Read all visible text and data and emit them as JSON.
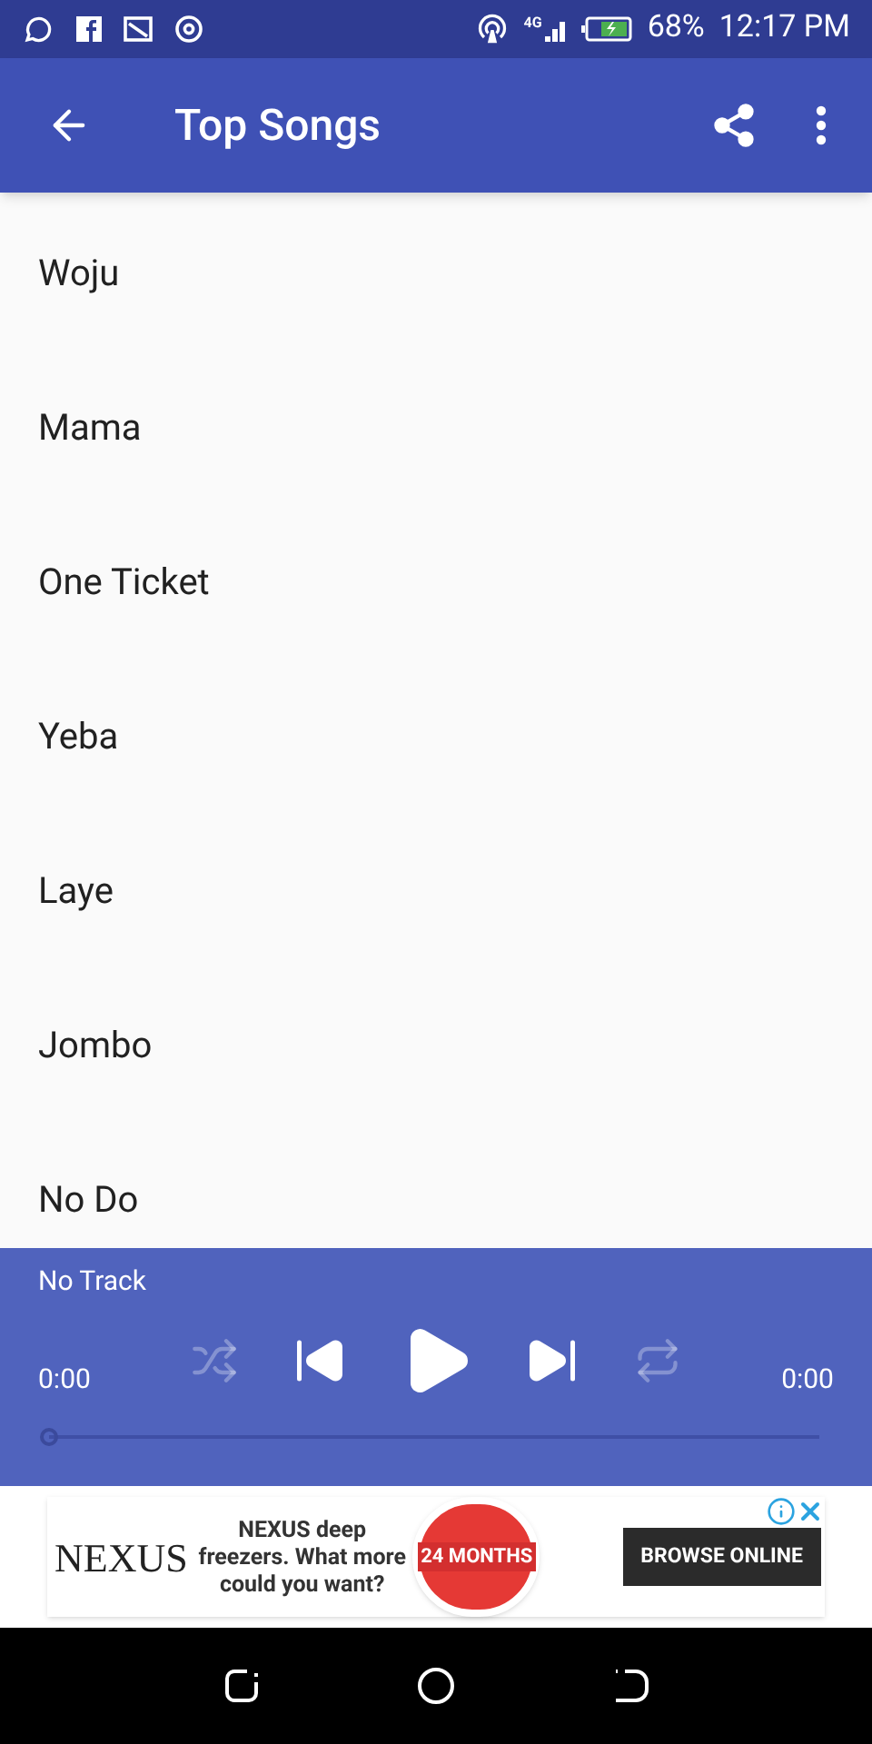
{
  "status_bar": {
    "network": "4G",
    "battery": "68%",
    "time": "12:17 PM"
  },
  "app_bar": {
    "title": "Top Songs"
  },
  "songs": [
    {
      "title": "Woju"
    },
    {
      "title": "Mama"
    },
    {
      "title": "One Ticket"
    },
    {
      "title": "Yeba"
    },
    {
      "title": "Laye"
    },
    {
      "title": "Jombo"
    },
    {
      "title": "No Do"
    }
  ],
  "player": {
    "track": "No Track",
    "elapsed": "0:00",
    "duration": "0:00",
    "level": 0,
    "controls": [
      {
        "kind": "shuffle",
        "disabled": true
      },
      {
        "kind": "previous",
        "disabled": false
      },
      {
        "kind": "play",
        "disabled": false
      },
      {
        "kind": "next",
        "disabled": false
      },
      {
        "kind": "repeat",
        "disabled": true
      }
    ]
  },
  "ad": {
    "brand": "NEXUS",
    "headline": "NEXUS deep freezers. What more could you want?",
    "badge": "24 MONTHS",
    "button": "BROWSE ONLINE"
  }
}
